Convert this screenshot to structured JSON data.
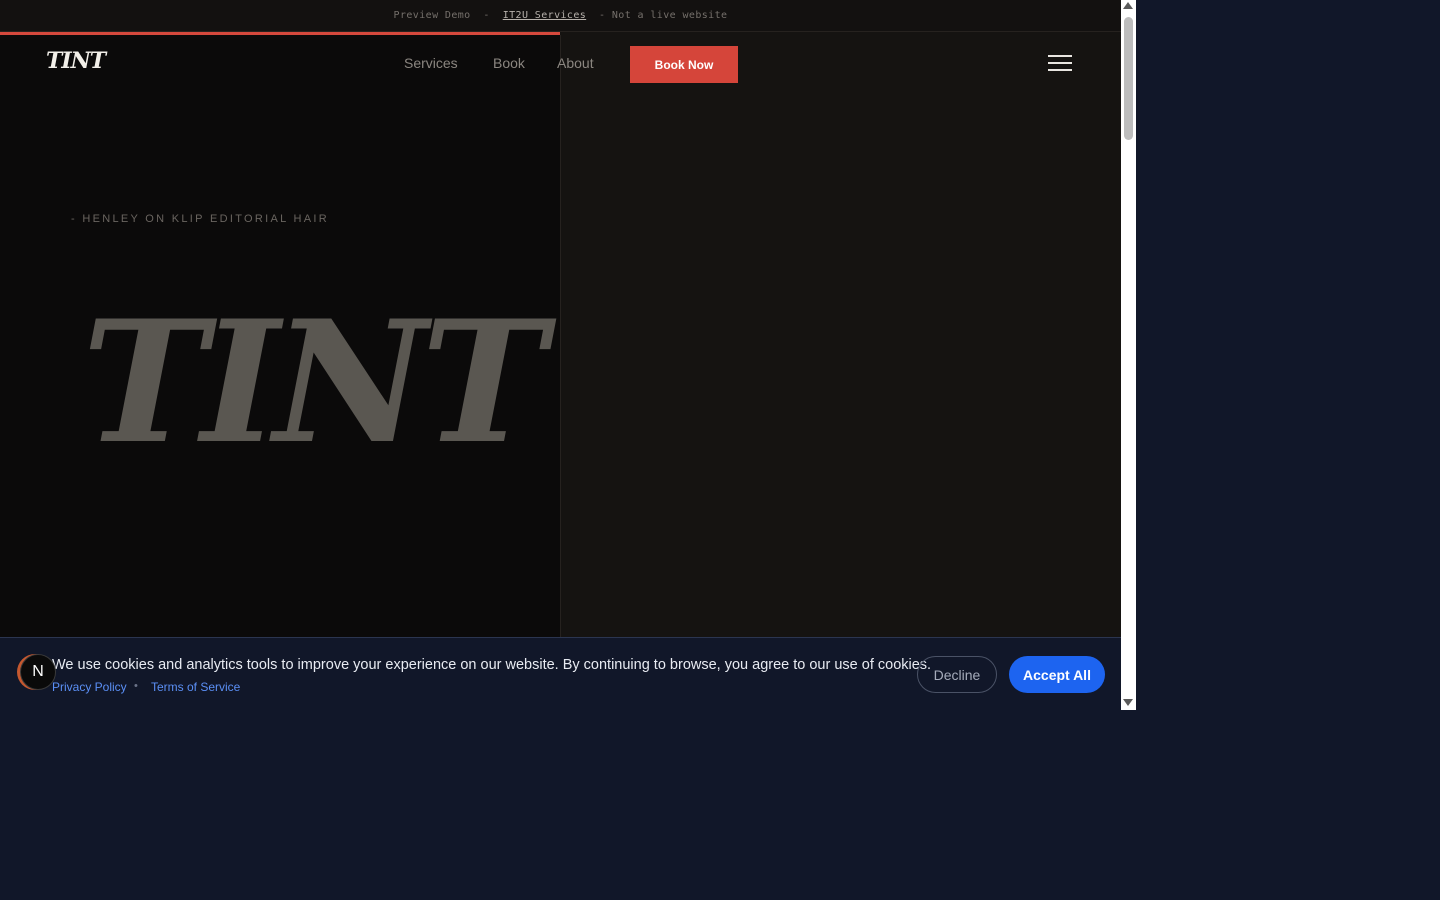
{
  "preview_bar": {
    "prefix": "Preview Demo  -  ",
    "link": "IT2U Services",
    "suffix": "  - Not a live website"
  },
  "header": {
    "logo": "TINT",
    "nav": [
      "Services",
      "Book",
      "About"
    ],
    "cta": "Book Now"
  },
  "hero": {
    "eyebrow": "- HENLEY ON KLIP EDITORIAL HAIR",
    "wordmark": "TINT"
  },
  "cookie": {
    "message": "We use cookies and analytics tools to improve your experience on our website. By continuing to browse, you agree to our use of cookies.",
    "privacy": "Privacy Policy",
    "separator": "•",
    "terms": "Terms of Service",
    "decline": "Decline",
    "accept": "Accept All"
  },
  "badge": {
    "letter": "N"
  },
  "colors": {
    "accent": "#d5453a",
    "banner_bg": "#111729",
    "accept_bg": "#1d64f0"
  }
}
